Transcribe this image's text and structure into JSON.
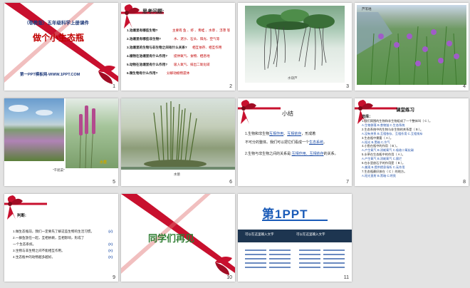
{
  "slides": [
    {
      "num": "1",
      "pub": "（鄂教版）五年级科学上册课件",
      "title": "做个小生态瓶",
      "footer": "第一PPT模板网-WWW.1PPT.COM"
    },
    {
      "num": "2",
      "heading": "思考问题:",
      "q1": "1.池塘里有哪些生物?",
      "q1a": "主要有 鱼 、虾 、青蛙 、水草 、浮萍 等",
      "q2": "2.池塘里有哪些非生物?",
      "q2a": "水、泥沙、石头、阳光、空气等",
      "q3": "3.池塘里的生物与非生物之间有什么关系?",
      "q3a": "相互依存、相互作用",
      "q4": "4.植物在池塘里有什么作用?",
      "q4a": "提供氧气、食物、栖息地",
      "q5": "5.动物在池塘里有什么作用?",
      "q5a": "吸入氧气、排出二氧化碳",
      "q6": "6.微生物有什么作用?",
      "q6a": "分解动植物遗体"
    },
    {
      "num": "3",
      "caption": "水葫芦"
    },
    {
      "num": "4",
      "caption": "芦苇地"
    },
    {
      "num": "5",
      "caption": "\"千屈菜\"",
      "caption2": "水葱"
    },
    {
      "num": "6",
      "caption": "水葱"
    },
    {
      "num": "7",
      "heading": "小结",
      "p1a": "1.生物和非生物",
      "p1b": "互相作用",
      "p1c": "、",
      "p1d": "互相依存",
      "p1e": "，形成着",
      "p2": "不可分的整体。我们可以把它们看成一个",
      "p2b": "生态系统",
      "p2c": "。",
      "p3a": "2.生物与非生物之间的关系是:",
      "p3b": "互相作用、互相依存",
      "p3c": "的关系。"
    },
    {
      "num": "8",
      "heading": "课堂练习",
      "sub": "选择：",
      "lines": [
        "1.我们周围的生物和非生物组成了一个整体叫（ C ）。",
        "A.生物群落  B.食物链  C.生态系统",
        "2.生态系统中的生物与非生物的关系是（ B ）。",
        "A.没有关系  B.互相依存、互相作用  C.互相排斥",
        "3.生态瓶中需要（ A ）。",
        "A.阳光  B.黑暗  C.冷气",
        "4.小鱼在瓶中的作用（ B ）。",
        "A.产生氧气  B.消耗氧气  C.吸收二氧化碳",
        "5.水草在生态瓶中的作用（ A ）。",
        "A.产生氧气  B.消耗氧气  C.腐烂",
        "6.在水里放石子的作用是（ B ）。",
        "A.美观  B.提供栖息场所  C.无作用",
        "7.生态瓶最好放在（ C ）的地方。",
        "A.阳光直射  B.黑暗  C.明亮"
      ]
    },
    {
      "num": "9",
      "heading": "判断:",
      "items": [
        {
          "text": "1.做生态瓶前，我们一定要先了解这些生物的生活习惯。",
          "ans": "(√)"
        },
        {
          "text": "2.一群鱼放在一起，互相依赖，互相影响，形成了",
          "ans": ""
        },
        {
          "text": "一个生态系统。",
          "ans": "(×)"
        },
        {
          "text": "3.生物与非生物之间不能相互作用。",
          "ans": "(×)"
        },
        {
          "text": "4.生态瓶中的动物越多越好。",
          "ans": "(×)"
        }
      ]
    },
    {
      "num": "10",
      "title": "同学们再见"
    },
    {
      "num": "11",
      "logo": "第1PPT",
      "col1": "可以在这里输入文字",
      "col2": "可以在这里输入文字"
    }
  ],
  "colors": {
    "ribbon": "#c8102e",
    "title_red": "#c00000",
    "blue": "#1f4fa8",
    "logo_blue": "#1a5bb8"
  }
}
